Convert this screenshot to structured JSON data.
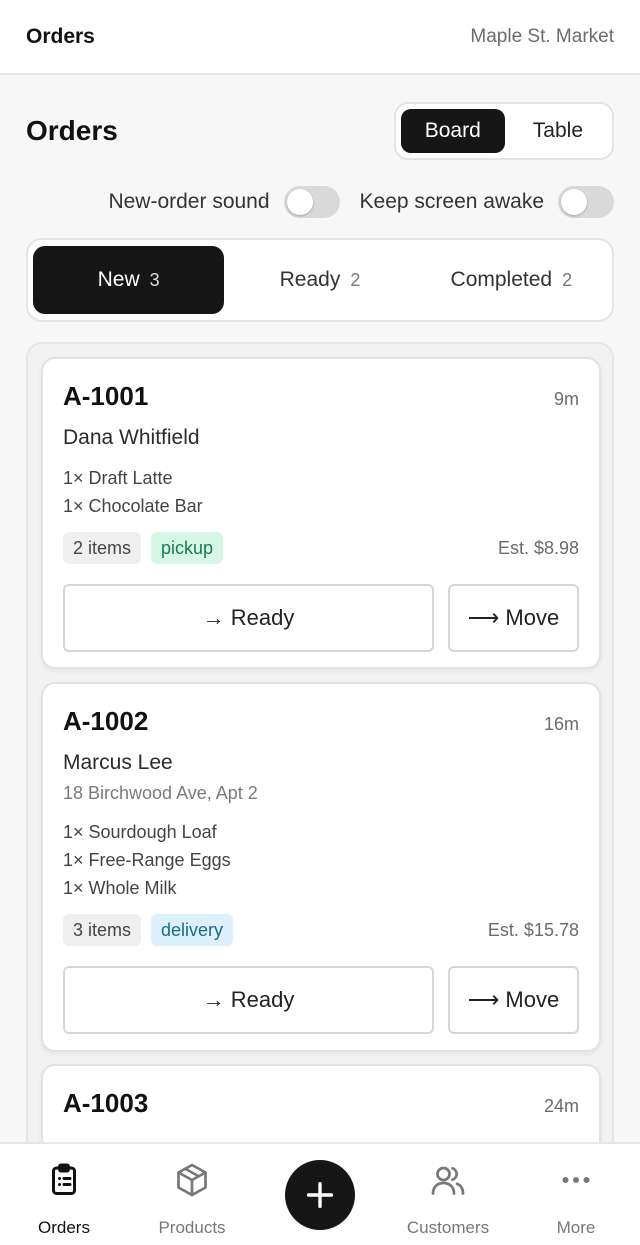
{
  "topbar": {
    "title": "Orders",
    "store": "Maple St. Market"
  },
  "page": {
    "title": "Orders",
    "view_toggle": {
      "board": "Board",
      "table": "Table",
      "active": "Board"
    }
  },
  "settings": {
    "sound_label": "New-order sound",
    "sound_on": false,
    "awake_label": "Keep screen awake",
    "awake_on": false
  },
  "status_tabs": [
    {
      "label": "New",
      "count": "3",
      "active": true
    },
    {
      "label": "Ready",
      "count": "2",
      "active": false
    },
    {
      "label": "Completed",
      "count": "2",
      "active": false
    }
  ],
  "orders": [
    {
      "id": "A-1001",
      "age": "9m",
      "customer": "Dana Whitfield",
      "items": [
        "1× Draft Latte",
        "1× Chocolate Bar"
      ],
      "item_count": "2 items",
      "fulfillment": "pickup",
      "estimate": "Est. $8.98",
      "primary_action": "→ Ready",
      "move_action": "⟶ Move"
    },
    {
      "id": "A-1002",
      "age": "16m",
      "customer": "Marcus Lee",
      "address": "18 Birchwood Ave, Apt 2",
      "items": [
        "1× Sourdough Loaf",
        "1× Free-Range Eggs",
        "1× Whole Milk"
      ],
      "item_count": "3 items",
      "fulfillment": "delivery",
      "estimate": "Est. $15.78",
      "primary_action": "→ Ready",
      "move_action": "⟶ Move"
    },
    {
      "id": "A-1003",
      "age": "24m"
    }
  ],
  "bottom_nav": {
    "orders": "Orders",
    "products": "Products",
    "customers": "Customers",
    "more": "More"
  },
  "icons": {
    "orders": "clipboard-icon",
    "products": "box-icon",
    "add": "plus-icon",
    "customers": "users-icon",
    "more": "more-horizontal-icon"
  },
  "colors": {
    "accent": "#161616",
    "pickup_bg": "#d7f7e6",
    "pickup_text": "#1c7a4a",
    "delivery_bg": "#dcf1fb",
    "delivery_text": "#1a6a8a"
  }
}
